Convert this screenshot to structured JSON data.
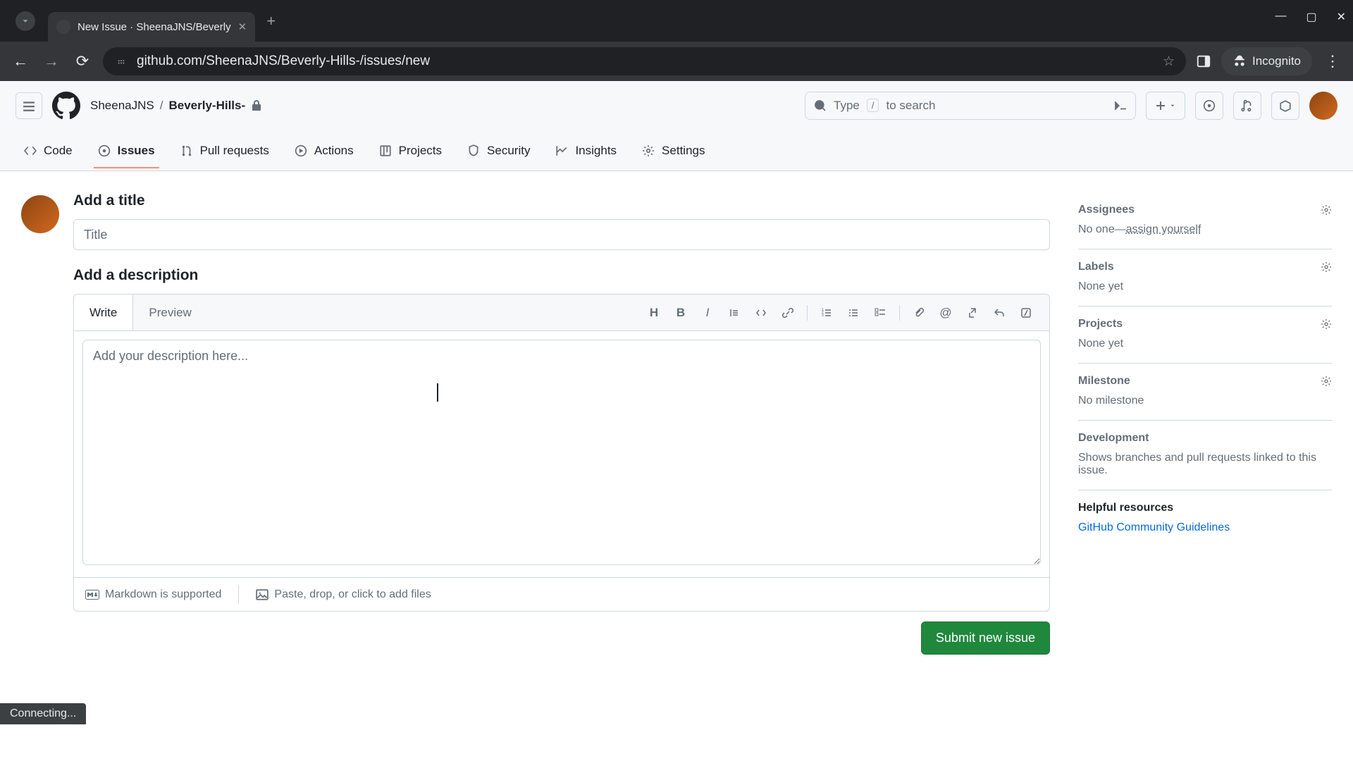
{
  "browser": {
    "tab_title": "New Issue · SheenaJNS/Beverly",
    "url": "github.com/SheenaJNS/Beverly-Hills-/issues/new",
    "incognito_label": "Incognito",
    "status": "Connecting..."
  },
  "header": {
    "owner": "SheenaJNS",
    "repo": "Beverly-Hills-",
    "search_hint_pre": "Type",
    "search_hint_key": "/",
    "search_hint_post": "to search"
  },
  "tabs": {
    "code": "Code",
    "issues": "Issues",
    "pulls": "Pull requests",
    "actions": "Actions",
    "projects": "Projects",
    "security": "Security",
    "insights": "Insights",
    "settings": "Settings"
  },
  "form": {
    "title_label": "Add a title",
    "title_placeholder": "Title",
    "desc_label": "Add a description",
    "write_tab": "Write",
    "preview_tab": "Preview",
    "body_placeholder": "Add your description here...",
    "markdown_note": "Markdown is supported",
    "files_note": "Paste, drop, or click to add files",
    "submit": "Submit new issue"
  },
  "sidebar": {
    "assignees_label": "Assignees",
    "assignees_body_pre": "No one—",
    "assignees_link": "assign yourself",
    "labels_label": "Labels",
    "labels_body": "None yet",
    "projects_label": "Projects",
    "projects_body": "None yet",
    "milestone_label": "Milestone",
    "milestone_body": "No milestone",
    "development_label": "Development",
    "development_body": "Shows branches and pull requests linked to this issue.",
    "resources_label": "Helpful resources",
    "resources_link": "GitHub Community Guidelines"
  },
  "footer": {
    "guidelines_link": "GitHub Community Guidelines",
    "suffix": "."
  }
}
